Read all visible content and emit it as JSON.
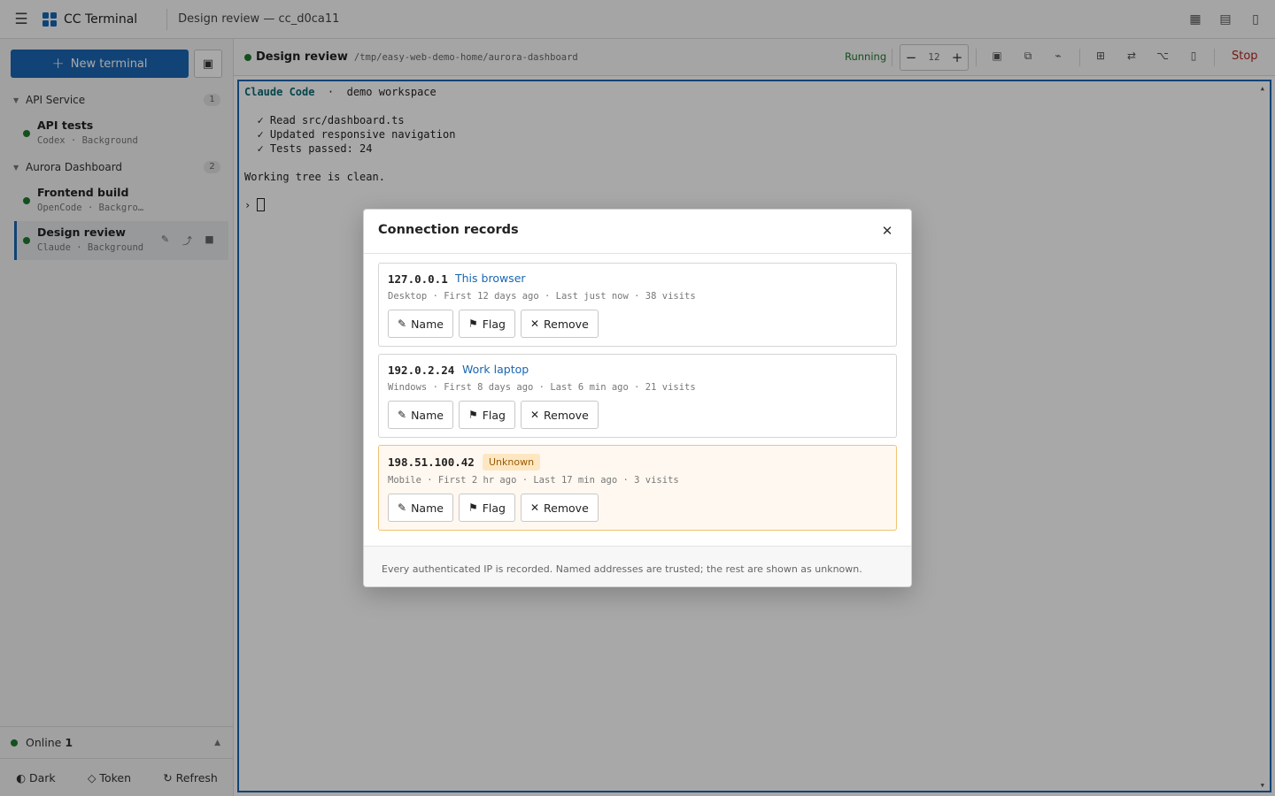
{
  "app": {
    "brand": "CC Terminal",
    "doc_title": "Design review — cc_d0ca11"
  },
  "topbar": {
    "menu_icon": "☰",
    "right_icons": [
      "grid-icon",
      "list-icon",
      "panel-icon"
    ]
  },
  "sidebar": {
    "new_terminal_label": "New terminal",
    "groups": [
      {
        "name": "API Service",
        "count": "1",
        "items": [
          {
            "title": "API tests",
            "subtitle": "Codex · Background"
          }
        ]
      },
      {
        "name": "Aurora Dashboard",
        "count": "2",
        "items": [
          {
            "title": "Frontend build",
            "subtitle": "OpenCode · Backgro…"
          },
          {
            "title": "Design review",
            "subtitle": "Claude · Background"
          }
        ]
      }
    ],
    "online_label": "Online",
    "online_count": "1",
    "footer": {
      "dark": "◐ Dark",
      "token": "◇ Token",
      "refresh": "↻ Refresh"
    }
  },
  "terminal": {
    "name": "Design review",
    "path": "/tmp/easy-web-demo-home/aurora-dashboard",
    "status": "Running",
    "font_size": "12",
    "stop_label": "Stop",
    "header_app": "Claude Code",
    "header_rest": "  ·  demo workspace",
    "lines": [
      "",
      "  ✓ Read src/dashboard.ts",
      "  ✓ Updated responsive navigation",
      "  ✓ Tests passed: 24",
      "",
      "Working tree is clean.",
      ""
    ],
    "prompt": "› "
  },
  "modal": {
    "title": "Connection records",
    "records": [
      {
        "ip": "127.0.0.1",
        "label": "This browser",
        "meta": "Desktop · First 12 days ago · Last just now · 38 visits",
        "buttons": {
          "name": "Name",
          "flag": "Flag",
          "remove": "Remove"
        }
      },
      {
        "ip": "192.0.2.24",
        "label": "Work laptop",
        "meta": "Windows · First 8 days ago · Last 6 min ago · 21 visits",
        "buttons": {
          "name": "Name",
          "flag": "Flag",
          "remove": "Remove"
        }
      },
      {
        "ip": "198.51.100.42",
        "badge": "Unknown",
        "meta": "Mobile · First 2 hr ago · Last 17 min ago · 3 visits",
        "buttons": {
          "name": "Name",
          "flag": "Flag",
          "remove": "Remove"
        }
      }
    ],
    "footer": "Every authenticated IP is recorded. Named addresses are trusted; the rest are shown as unknown."
  },
  "colors": {
    "accent": "#1a66b3",
    "status_ok": "#1f7a2e",
    "danger": "#b3261e",
    "warn_bg": "#fff8f0"
  }
}
